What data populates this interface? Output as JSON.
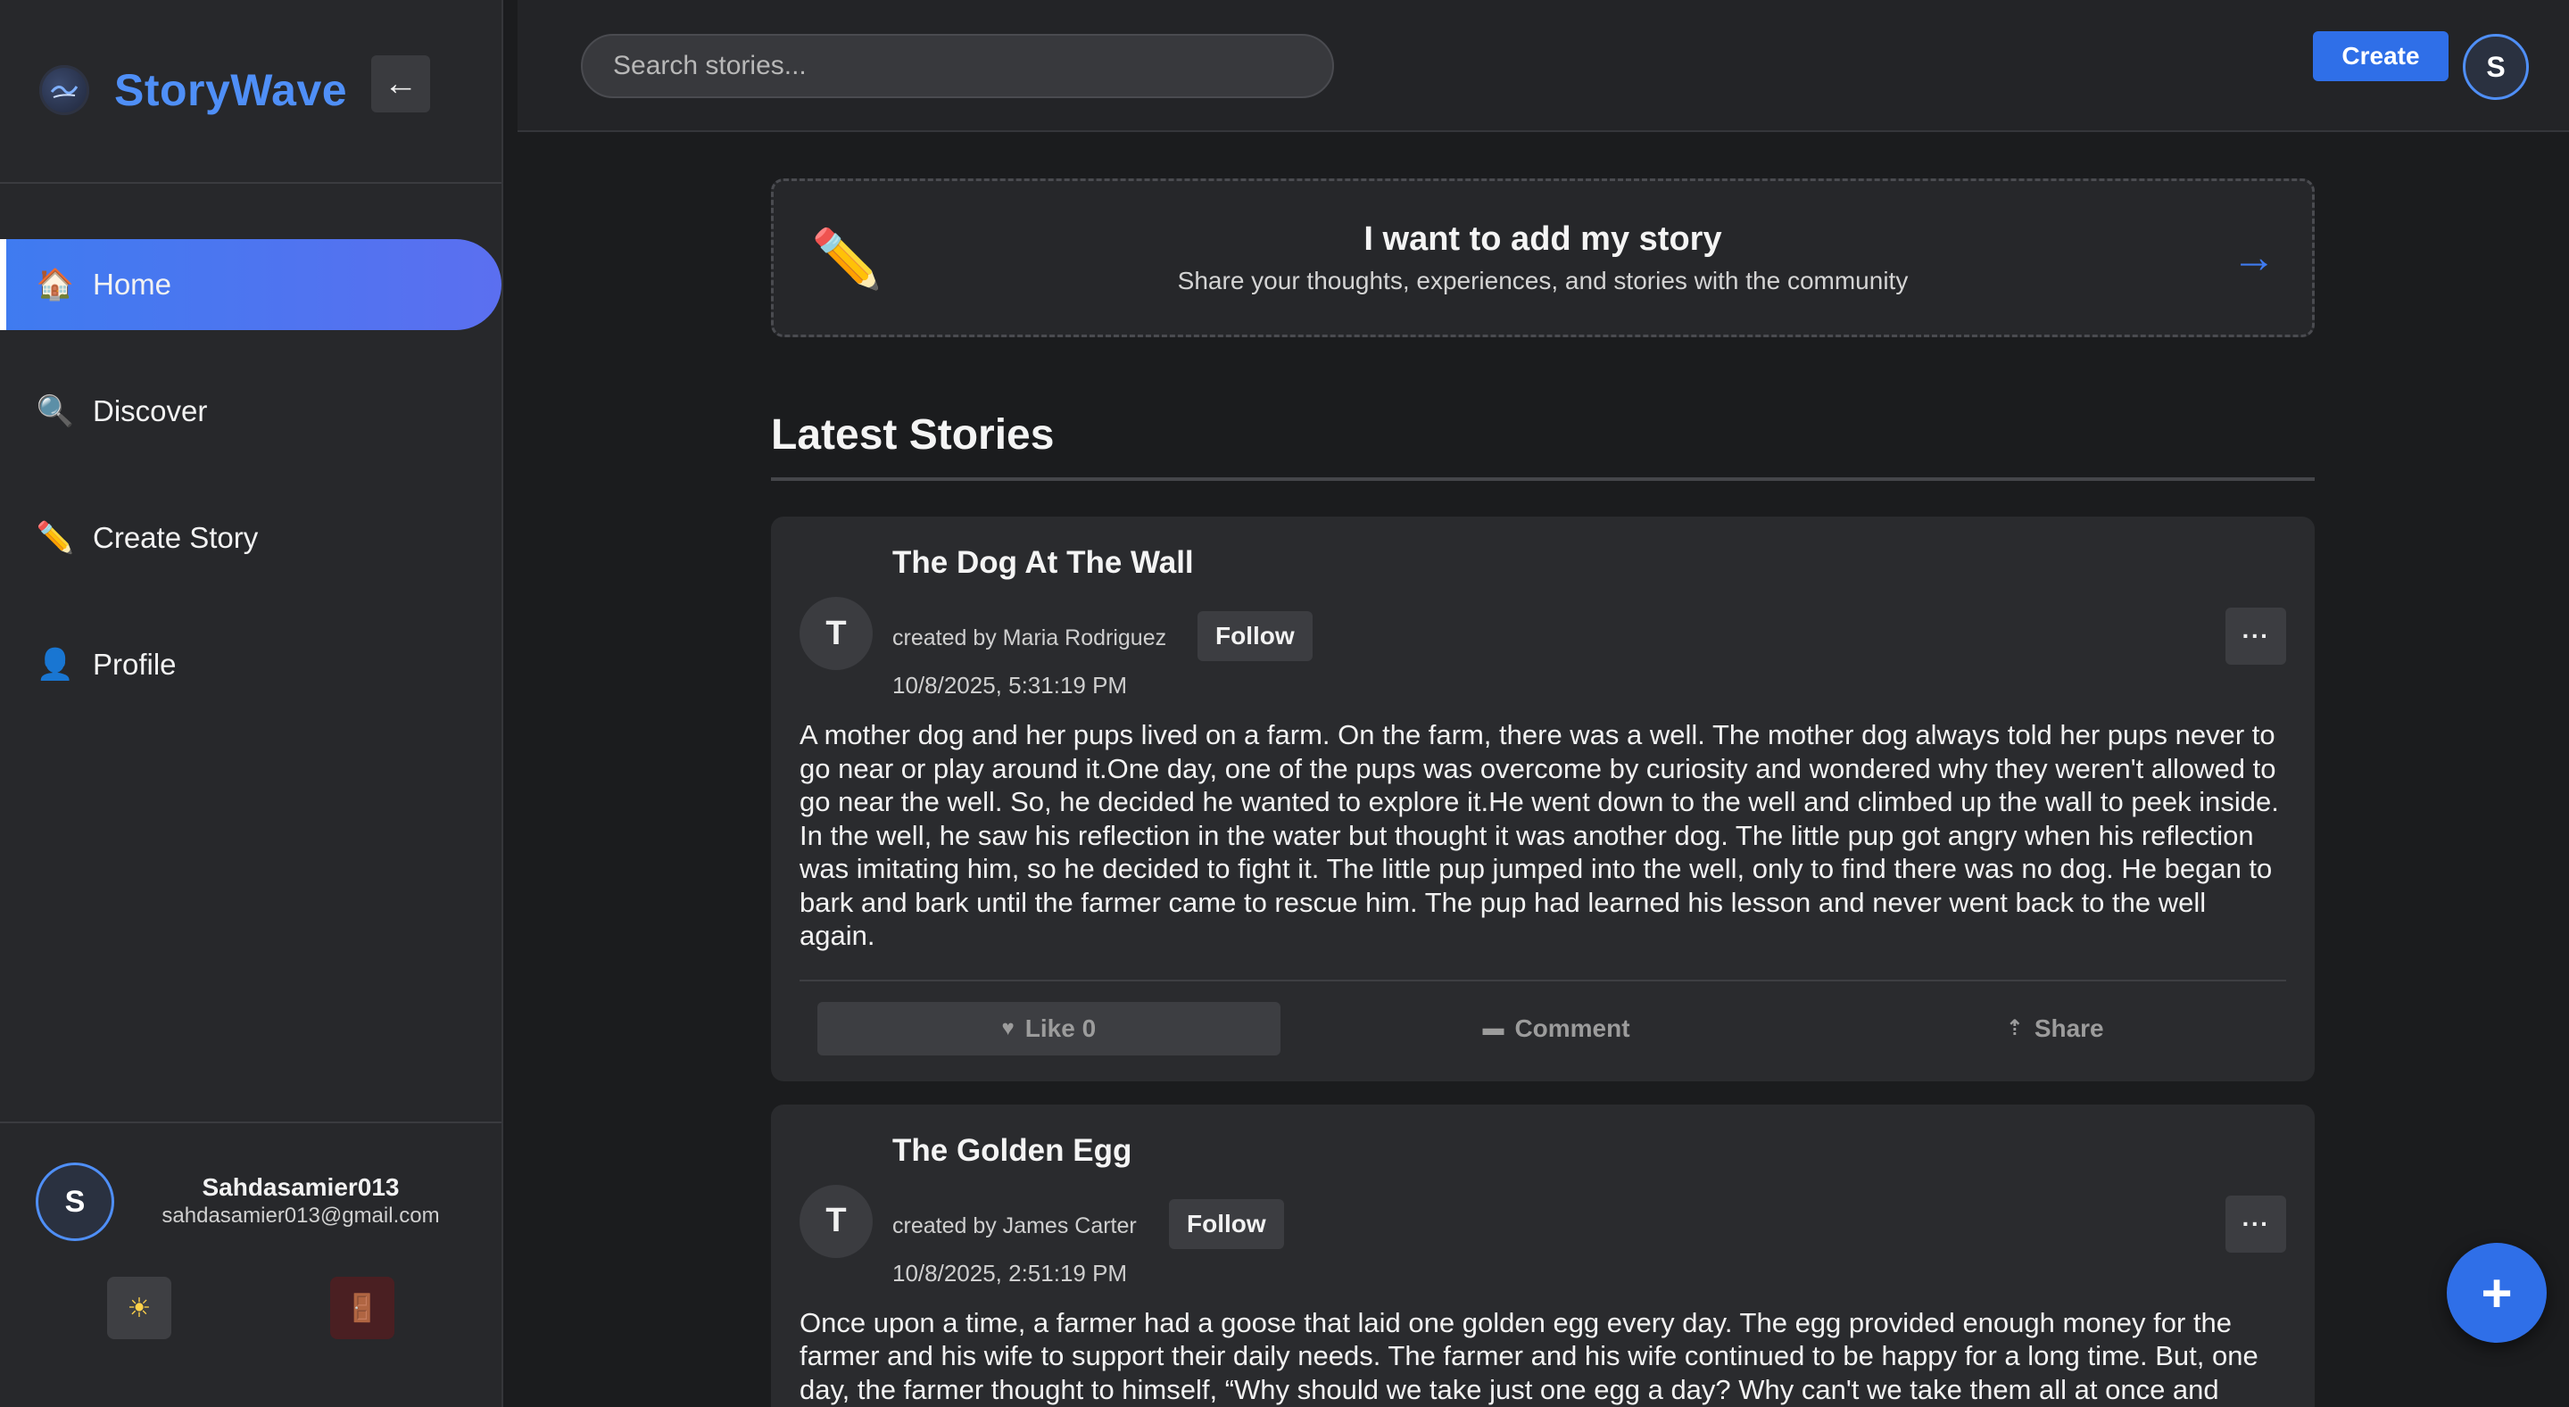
{
  "brand": {
    "name": "StoryWave",
    "collapse_icon": "←"
  },
  "nav": {
    "items": [
      {
        "icon": "🏠",
        "label": "Home"
      },
      {
        "icon": "🔍",
        "label": "Discover"
      },
      {
        "icon": "✏️",
        "label": "Create Story"
      },
      {
        "icon": "👤",
        "label": "Profile"
      }
    ]
  },
  "user": {
    "initial": "S",
    "name": "Sahdasamier013",
    "email": "sahdasamier013@gmail.com",
    "theme_icon": "☀",
    "logout_icon": "🚪"
  },
  "topbar": {
    "search_placeholder": "Search stories...",
    "create_label": "Create",
    "avatar_initial": "S"
  },
  "add_story": {
    "icon": "✏️",
    "title": "I want to add my story",
    "subtitle": "Share your thoughts, experiences, and stories with the community",
    "arrow": "→"
  },
  "section_title": "Latest Stories",
  "stories": [
    {
      "initial": "T",
      "title": "The Dog At The Wall",
      "author": "created by Maria Rodriguez",
      "follow_label": "Follow",
      "date": "10/8/2025, 5:31:19 PM",
      "more": "···",
      "body": "A mother dog and her pups lived on a farm. On the farm, there was a well. The mother dog always told her pups never to go near or play around it.One day, one of the pups was overcome by curiosity and wondered why they weren't allowed to go near the well. So, he decided he wanted to explore it.He went down to the well and climbed up the wall to peek inside. In the well, he saw his reflection in the water but thought it was another dog. The little pup got angry when his reflection was imitating him, so he decided to fight it. The little pup jumped into the well, only to find there was no dog. He began to bark and bark until the farmer came to rescue him. The pup had learned his lesson and never went back to the well again.",
      "like_label": "Like 0",
      "comment_label": "Comment",
      "share_label": "Share"
    },
    {
      "initial": "T",
      "title": "The Golden Egg",
      "author": "created by James Carter",
      "follow_label": "Follow",
      "date": "10/8/2025, 2:51:19 PM",
      "more": "···",
      "body": "Once upon a time, a farmer had a goose that laid one golden egg every day. The egg provided enough money for the farmer and his wife to support their daily needs. The farmer and his wife continued to be happy for a long time. But, one day, the farmer thought to himself, “Why should we take just one egg a day? Why can't we take them all at once and make a lot of money?” The farmer told his wife his idea, and she foolishly agreed.Then, the next day, as"
    }
  ],
  "fab_label": "+"
}
